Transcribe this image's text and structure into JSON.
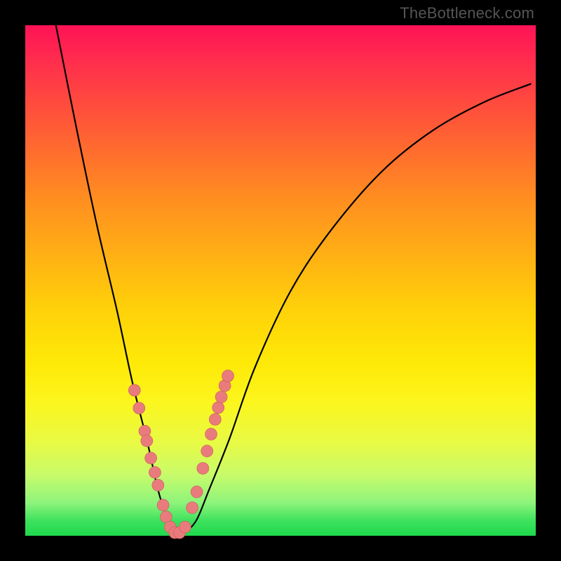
{
  "watermark": "TheBottleneck.com",
  "colors": {
    "frame": "#000000",
    "gradient_top": "#ff1255",
    "gradient_bottom": "#1ed94d",
    "curve": "#000000",
    "marker_fill": "#e97b7d",
    "marker_stroke": "#c95a5c"
  },
  "chart_data": {
    "type": "line",
    "title": "",
    "xlabel": "",
    "ylabel": "",
    "xlim": [
      0,
      100
    ],
    "ylim": [
      0,
      100
    ],
    "grid": false,
    "notes": "V-shaped bottleneck curve on a rainbow-gradient background. Values are read from pixel positions because the chart has no axis ticks; y approximates relative bottleneck severity (0 at the valley floor, 100 at the top of the gradient).",
    "series": [
      {
        "name": "bottleneck-curve",
        "x": [
          6,
          10,
          14,
          18,
          21,
          24,
          26,
          28,
          29.5,
          31,
          33.5,
          36,
          40,
          45,
          52,
          60,
          70,
          80,
          90,
          99
        ],
        "y": [
          100,
          80,
          61,
          44,
          30,
          18,
          9,
          3,
          0.5,
          0.5,
          3,
          9,
          19,
          33,
          48,
          60,
          71.5,
          79.5,
          85,
          88.5
        ]
      }
    ],
    "markers": {
      "name": "highlighted-points",
      "description": "salmon-colored dots clustered near the valley on both arms of the V",
      "x": [
        21.4,
        22.3,
        23.4,
        23.8,
        24.6,
        25.4,
        26.0,
        27.0,
        27.6,
        28.4,
        29.3,
        30.2,
        31.3,
        32.7,
        33.6,
        34.8,
        35.6,
        36.4,
        37.2,
        37.8,
        38.4,
        39.1,
        39.7
      ],
      "y": [
        28.5,
        25.0,
        20.5,
        18.6,
        15.2,
        12.4,
        9.9,
        6.0,
        3.7,
        1.7,
        0.6,
        0.6,
        1.7,
        5.5,
        8.6,
        13.2,
        16.6,
        19.9,
        22.8,
        25.1,
        27.2,
        29.4,
        31.3
      ]
    }
  }
}
